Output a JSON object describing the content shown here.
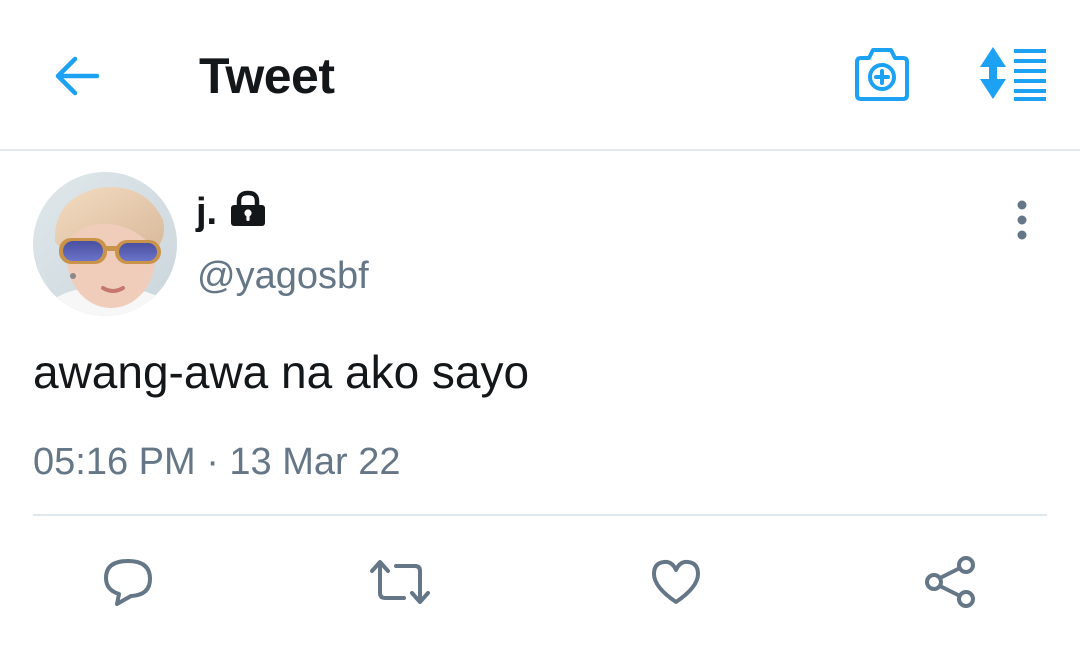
{
  "header": {
    "title": "Tweet",
    "back_icon": "arrow-left-icon",
    "camera_icon": "camera-plus-icon",
    "sort_icon": "sort-lines-icon"
  },
  "tweet": {
    "author": {
      "display_name": "j.",
      "handle": "@yagosbf",
      "protected": true,
      "lock_icon": "lock-icon"
    },
    "text": "awang-awa na ako sayo",
    "timestamp": "05:16 PM · 13 Mar 22",
    "more_icon": "more-vertical-icon"
  },
  "actions": [
    {
      "name": "reply",
      "icon": "comment-icon"
    },
    {
      "name": "retweet",
      "icon": "retweet-icon"
    },
    {
      "name": "like",
      "icon": "heart-icon"
    },
    {
      "name": "share",
      "icon": "share-icon"
    }
  ],
  "colors": {
    "accent": "#1da1f2",
    "text_primary": "#14171a",
    "text_secondary": "#657786",
    "divider": "#e1e8ed"
  }
}
